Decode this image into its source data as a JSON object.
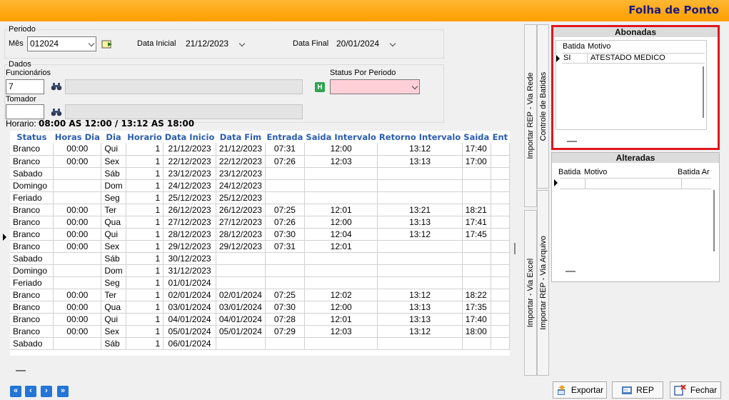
{
  "window": {
    "title": "Folha de Ponto"
  },
  "periodo": {
    "legend": "Periodo",
    "mes_label": "Mês",
    "mes_value": "012024",
    "data_inicial_label": "Data Inicial",
    "data_inicial_value": "21/12/2023",
    "data_final_label": "Data Final",
    "data_final_value": "20/01/2024"
  },
  "dados": {
    "legend": "Dados",
    "funcionarios_label": "Funcionários",
    "funcionario_value": "7",
    "tomador_label": "Tomador",
    "tomador_value": "",
    "status_label": "Status Por Periodo",
    "status_value": "",
    "horario_label": "Horario:",
    "horario_value": "08:00 AS 12:00 / 13:12 AS 18:00"
  },
  "grid": {
    "columns": [
      "Status",
      "Horas Dia",
      "Dia",
      "Horario",
      "Data Inicio",
      "Data Fim",
      "Entrada",
      "Saida Intervalo",
      "Retorno Intervalo",
      "Saida",
      "Ent"
    ],
    "rows": [
      [
        "Branco",
        "00:00",
        "Qui",
        "1",
        "21/12/2023",
        "21/12/2023",
        "07:31",
        "12:00",
        "13:12",
        "17:40",
        ""
      ],
      [
        "Branco",
        "00:00",
        "Sex",
        "1",
        "22/12/2023",
        "22/12/2023",
        "07:26",
        "12:03",
        "13:13",
        "17:00",
        ""
      ],
      [
        "Sabado",
        "",
        "Sáb",
        "1",
        "23/12/2023",
        "23/12/2023",
        "",
        "",
        "",
        "",
        ""
      ],
      [
        "Domingo",
        "",
        "Dom",
        "1",
        "24/12/2023",
        "24/12/2023",
        "",
        "",
        "",
        "",
        ""
      ],
      [
        "Feriado",
        "",
        "Seg",
        "1",
        "25/12/2023",
        "25/12/2023",
        "",
        "",
        "",
        "",
        ""
      ],
      [
        "Branco",
        "00:00",
        "Ter",
        "1",
        "26/12/2023",
        "26/12/2023",
        "07:25",
        "12:01",
        "13:21",
        "18:21",
        ""
      ],
      [
        "Branco",
        "00:00",
        "Qua",
        "1",
        "27/12/2023",
        "27/12/2023",
        "07:26",
        "12:00",
        "13:13",
        "17:41",
        ""
      ],
      [
        "Branco",
        "00:00",
        "Qui",
        "1",
        "28/12/2023",
        "28/12/2023",
        "07:30",
        "12:04",
        "13:12",
        "17:45",
        ""
      ],
      [
        "Branco",
        "00:00",
        "Sex",
        "1",
        "29/12/2023",
        "29/12/2023",
        "07:31",
        "12:01",
        "",
        "",
        ""
      ],
      [
        "Sabado",
        "",
        "Sáb",
        "1",
        "30/12/2023",
        "",
        "",
        "",
        "",
        "",
        ""
      ],
      [
        "Domingo",
        "",
        "Dom",
        "1",
        "31/12/2023",
        "",
        "",
        "",
        "",
        "",
        ""
      ],
      [
        "Feriado",
        "",
        "Seg",
        "1",
        "01/01/2024",
        "",
        "",
        "",
        "",
        "",
        ""
      ],
      [
        "Branco",
        "00:00",
        "Ter",
        "1",
        "02/01/2024",
        "02/01/2024",
        "07:25",
        "12:02",
        "13:12",
        "18:22",
        ""
      ],
      [
        "Branco",
        "00:00",
        "Qua",
        "1",
        "03/01/2024",
        "03/01/2024",
        "07:30",
        "12:00",
        "13:13",
        "17:35",
        ""
      ],
      [
        "Branco",
        "00:00",
        "Qui",
        "1",
        "04/01/2024",
        "04/01/2024",
        "07:28",
        "12:01",
        "13:13",
        "17:40",
        ""
      ],
      [
        "Branco",
        "00:00",
        "Sex",
        "1",
        "05/01/2024",
        "05/01/2024",
        "07:29",
        "12:03",
        "13:12",
        "18:00",
        ""
      ],
      [
        "Sabado",
        "",
        "Sáb",
        "1",
        "06/01/2024",
        "",
        "",
        "",
        "",
        "",
        ""
      ]
    ]
  },
  "tabs": {
    "rep_rede": "Importar REP - Via Rede",
    "controle_batidas": "Controle de Batidas",
    "excel": "Importar - Via Excel",
    "rep_arquivo": "Importar REP - Via Arquivo"
  },
  "abonadas": {
    "title": "Abonadas",
    "columns": [
      "Batida",
      "Motivo"
    ],
    "rows": [
      [
        "SI",
        "ATESTADO MEDICO"
      ]
    ]
  },
  "alteradas": {
    "title": "Alteradas",
    "columns": [
      "Batida",
      "Motivo",
      "Batida Ar"
    ]
  },
  "buttons": {
    "exportar": "Exportar",
    "rep": "REP",
    "fechar": "Fechar"
  },
  "nav": {
    "first": "«",
    "prev": "‹",
    "next": "›",
    "last": "»"
  },
  "colors": {
    "highlight_border": "#e0161e",
    "header_text": "#2a5db0",
    "title_bar": "#ffa500",
    "status_combo": "#ffd0d8"
  }
}
